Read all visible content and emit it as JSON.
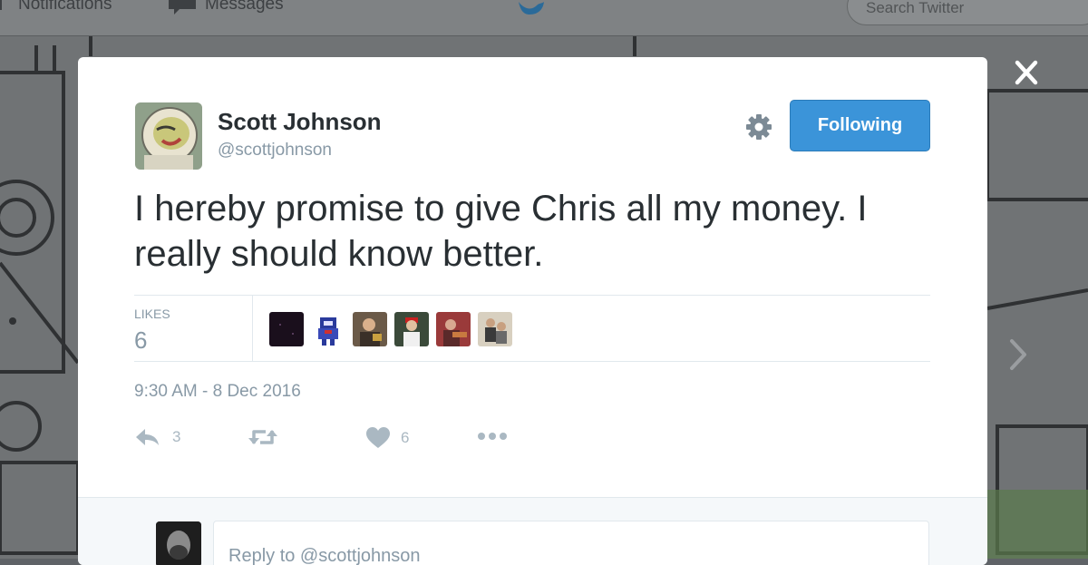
{
  "topbar": {
    "notifications_label": "Notifications",
    "messages_label": "Messages",
    "search_placeholder": "Search Twitter"
  },
  "tweet": {
    "author_name": "Scott Johnson",
    "author_handle": "@scottjohnson",
    "follow_button_label": "Following",
    "text": "I hereby promise to give Chris all my money. I really should know better.",
    "likes_label": "LIKES",
    "likes_count": "6",
    "timestamp": "9:30 AM - 8 Dec 2016",
    "reply_count": "3",
    "like_count": "6"
  },
  "reply": {
    "placeholder": "Reply to @scottjohnson"
  },
  "colors": {
    "accent": "#3b94d9",
    "text_primary": "#292f33",
    "text_secondary": "#8899a6",
    "icon": "#aab8c2",
    "border": "#e1e8ed"
  },
  "icons": {
    "settings": "gear-icon",
    "reply": "reply-icon",
    "retweet": "retweet-icon",
    "like": "heart-icon",
    "more": "more-icon",
    "close": "close-icon",
    "next": "chevron-right-icon"
  }
}
